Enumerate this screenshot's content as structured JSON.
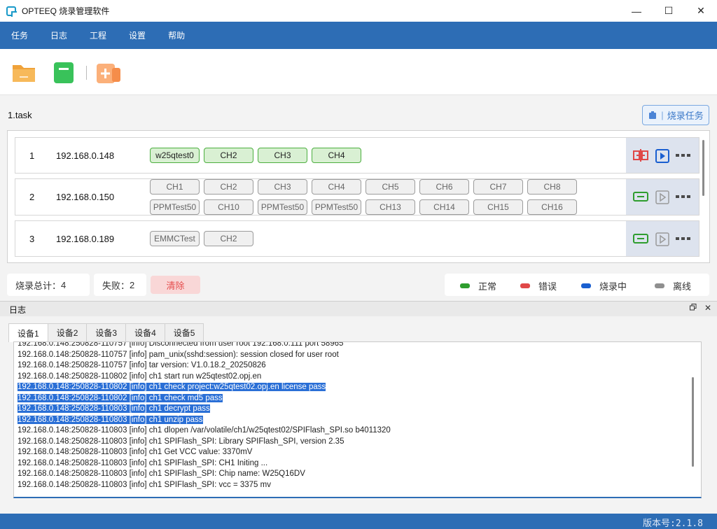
{
  "window": {
    "title": "OPTEEQ 烧录管理软件",
    "minimize_glyph": "—",
    "maximize_glyph": "☐",
    "close_glyph": "✕"
  },
  "menu": [
    "任务",
    "日志",
    "工程",
    "设置",
    "帮助"
  ],
  "toolbar": {
    "icons": [
      "open-folder-icon",
      "green-device-icon",
      "add-task-icon"
    ]
  },
  "task": {
    "title": "1.task",
    "burn_button_label": "烧录任务"
  },
  "devices": [
    {
      "index": "1",
      "ip": "192.168.0.148",
      "channels": [
        {
          "label": "w25qtest0",
          "state": "active"
        },
        {
          "label": "CH2",
          "state": "active"
        },
        {
          "label": "CH3",
          "state": "active"
        },
        {
          "label": "CH4",
          "state": "active"
        }
      ],
      "status": "error"
    },
    {
      "index": "2",
      "ip": "192.168.0.150",
      "channels": [
        {
          "label": "CH1",
          "state": "idle"
        },
        {
          "label": "CH2",
          "state": "idle"
        },
        {
          "label": "CH3",
          "state": "idle"
        },
        {
          "label": "CH4",
          "state": "idle"
        },
        {
          "label": "CH5",
          "state": "idle"
        },
        {
          "label": "CH6",
          "state": "idle"
        },
        {
          "label": "CH7",
          "state": "idle"
        },
        {
          "label": "CH8",
          "state": "idle"
        },
        {
          "label": "PPMTest50",
          "state": "idle"
        },
        {
          "label": "CH10",
          "state": "idle"
        },
        {
          "label": "PPMTest50",
          "state": "idle"
        },
        {
          "label": "PPMTest50",
          "state": "idle"
        },
        {
          "label": "CH13",
          "state": "idle"
        },
        {
          "label": "CH14",
          "state": "idle"
        },
        {
          "label": "CH15",
          "state": "idle"
        },
        {
          "label": "CH16",
          "state": "idle"
        }
      ],
      "status": "normal"
    },
    {
      "index": "3",
      "ip": "192.168.0.189",
      "channels": [
        {
          "label": "EMMCTest",
          "state": "idle"
        },
        {
          "label": "CH2",
          "state": "idle"
        }
      ],
      "status": "normal"
    }
  ],
  "stats": {
    "total_label": "烧录总计：",
    "total_value": "4",
    "fail_label": "失败：",
    "fail_value": "2",
    "clear_label": "清除"
  },
  "legend": [
    {
      "label": "正常",
      "color": "#2e9d2e"
    },
    {
      "label": "错误",
      "color": "#e04848"
    },
    {
      "label": "烧录中",
      "color": "#1a5fd0"
    },
    {
      "label": "离线",
      "color": "#8f8f8f"
    }
  ],
  "log": {
    "title": "日志",
    "float_glyph": "🗗",
    "close_glyph": "✕",
    "tabs": [
      "设备1",
      "设备2",
      "设备3",
      "设备4",
      "设备5"
    ],
    "selected_tab": 0,
    "lines": [
      {
        "text": "192.168.0.148:250828-110757 [info] Disconnected from user root 192.168.0.111 port 58965",
        "selected": false
      },
      {
        "text": "192.168.0.148:250828-110757 [info] pam_unix(sshd:session): session closed for user root",
        "selected": false
      },
      {
        "text": "192.168.0.148:250828-110757 [info] tar version: V1.0.18.2_20250826",
        "selected": false
      },
      {
        "text": "192.168.0.148:250828-110802 [info] ch1 start run w25qtest02.opj.en",
        "selected": false
      },
      {
        "text": "192.168.0.148:250828-110802 [info] ch1 check project:w25qtest02.opj.en license pass",
        "selected": true
      },
      {
        "text": "192.168.0.148:250828-110802 [info] ch1 check md5 pass",
        "selected": true
      },
      {
        "text": "192.168.0.148:250828-110803 [info] ch1 decrypt pass",
        "selected": true
      },
      {
        "text": "192.168.0.148:250828-110803 [info] ch1 unzip pass",
        "selected": true
      },
      {
        "text": "192.168.0.148:250828-110803 [info] ch1 dlopen /var/volatile/ch1/w25qtest02/SPIFlash_SPI.so b4011320",
        "selected": false
      },
      {
        "text": "192.168.0.148:250828-110803 [info] ch1 SPIFlash_SPI: Library SPIFlash_SPI, version 2.35",
        "selected": false
      },
      {
        "text": "192.168.0.148:250828-110803 [info] ch1 Get VCC value: 3370mV",
        "selected": false
      },
      {
        "text": "192.168.0.148:250828-110803 [info] ch1 SPIFlash_SPI: CH1 Initing ...",
        "selected": false
      },
      {
        "text": "192.168.0.148:250828-110803 [info] ch1 SPIFlash_SPI: Chip name: W25Q16DV",
        "selected": false
      },
      {
        "text": "192.168.0.148:250828-110803 [info] ch1 SPIFlash_SPI: vcc = 3375 mv",
        "selected": false
      }
    ]
  },
  "statusbar": {
    "version": "版本号:2.1.8"
  }
}
